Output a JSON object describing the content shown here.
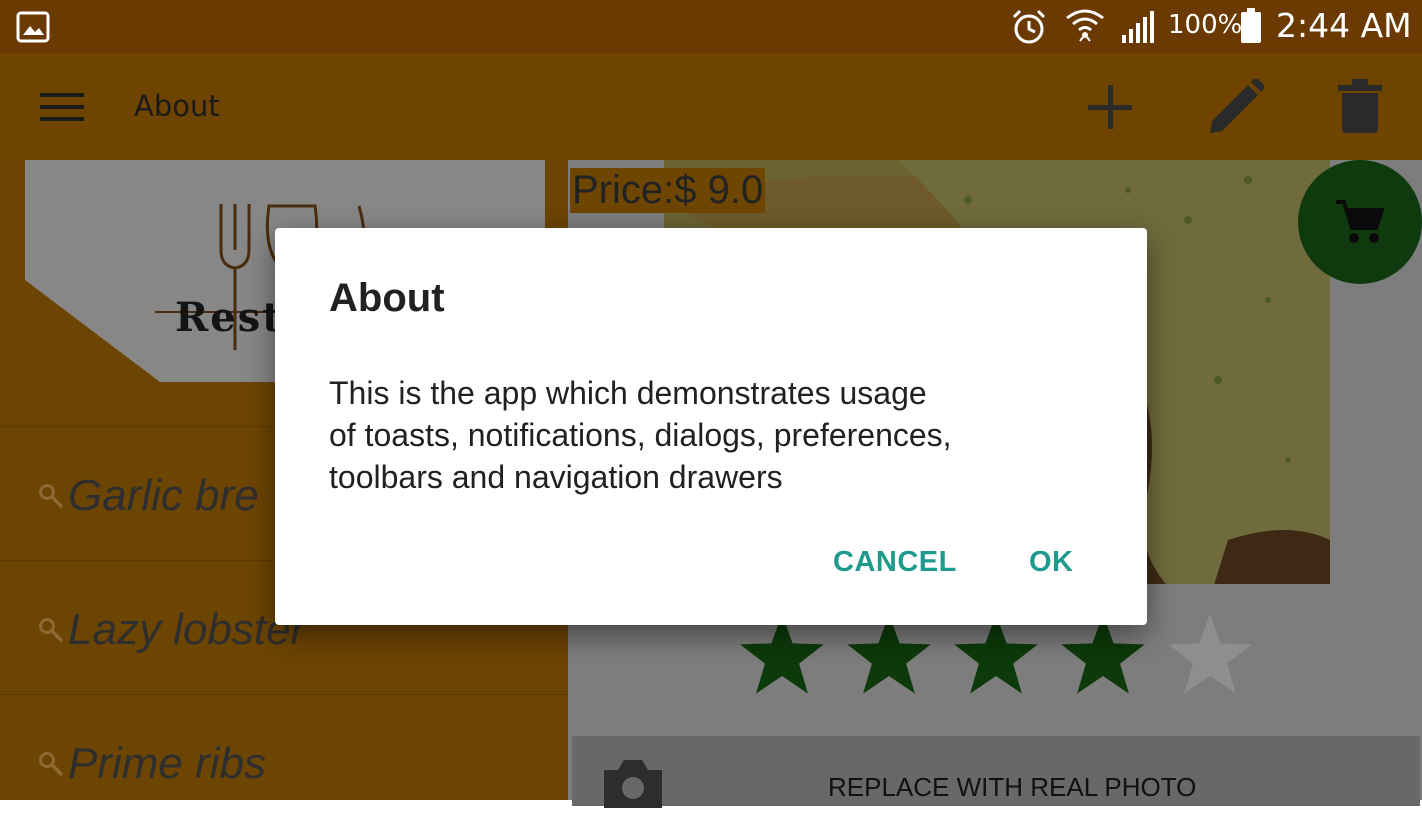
{
  "status_bar": {
    "battery_percent": "100%",
    "time": "2:44 AM",
    "icons": [
      "gallery-icon",
      "alarm-icon",
      "wifi-icon",
      "signal-icon",
      "battery-icon"
    ]
  },
  "toolbar": {
    "title": "About",
    "icons": [
      "menu-icon",
      "add-icon",
      "edit-icon",
      "delete-icon"
    ]
  },
  "drawer": {
    "header_logo_text": "Resta",
    "items": [
      {
        "label": "Garlic bre"
      },
      {
        "label": "Lazy lobster"
      },
      {
        "label": "Prime ribs"
      }
    ]
  },
  "content": {
    "price": "Price:$ 9.0",
    "rating": 4,
    "rating_max": 5,
    "replace_label": "REPLACE WITH REAL PHOTO"
  },
  "dialog": {
    "title": "About",
    "message_lines": [
      "This is the app which demonstrates usage",
      "of toasts, notifications, dialogs, preferences,",
      "toolbars and navigation drawers"
    ],
    "cancel_label": "CANCEL",
    "ok_label": "OK"
  },
  "colors": {
    "dialog_button": "#1f9a8c",
    "star_filled": "#0d3a0a",
    "star_empty": "#8e8e8e",
    "fab": "#0f3a0e"
  }
}
